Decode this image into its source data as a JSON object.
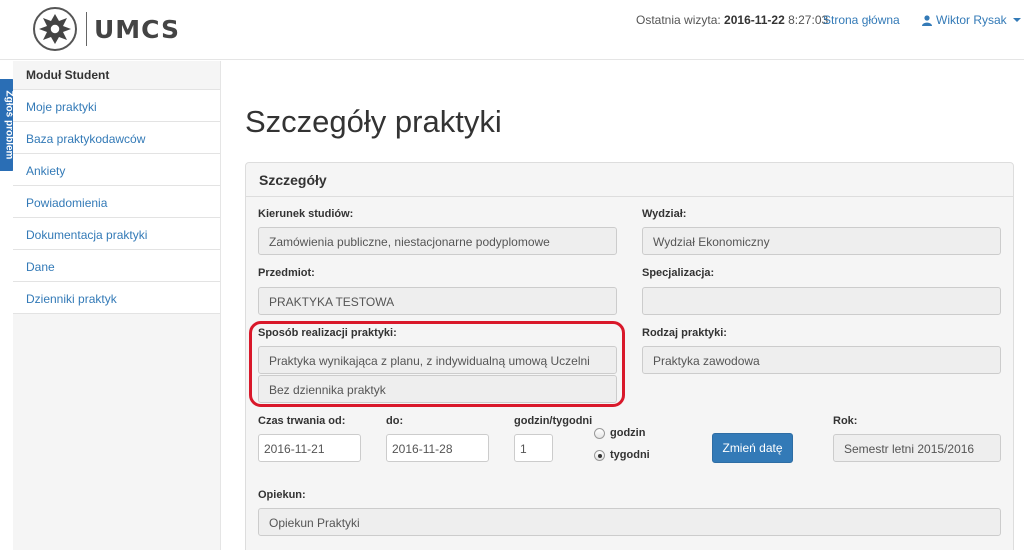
{
  "header": {
    "logo_text": "UMCS",
    "last_visit_label": "Ostatnia wizyta:",
    "last_visit_date": "2016-11-22",
    "last_visit_time": "8:27:03",
    "home_link": "Strona główna",
    "user_name": "Wiktor Rysak"
  },
  "feedback_tab": "Zgłoś problem",
  "sidebar": {
    "title": "Moduł Student",
    "items": [
      {
        "label": "Moje praktyki"
      },
      {
        "label": "Baza praktykodawców"
      },
      {
        "label": "Ankiety"
      },
      {
        "label": "Powiadomienia"
      },
      {
        "label": "Dokumentacja praktyki"
      },
      {
        "label": "Dane"
      },
      {
        "label": "Dzienniki praktyk"
      }
    ]
  },
  "main": {
    "page_title": "Szczegóły praktyki",
    "panel_title": "Szczegóły",
    "fields": {
      "kierunek": {
        "label": "Kierunek studiów:",
        "value": "Zamówienia publiczne, niestacjonarne podyplomowe"
      },
      "wydzial": {
        "label": "Wydział:",
        "value": "Wydział Ekonomiczny"
      },
      "przedmiot": {
        "label": "Przedmiot:",
        "value": "PRAKTYKA TESTOWA"
      },
      "specjalizacja": {
        "label": "Specjalizacja:",
        "value": ""
      },
      "sposob": {
        "label": "Sposób realizacji praktyki:",
        "value": "Praktyka wynikająca z planu, z indywidualną umową Uczelni",
        "value2": "Bez dziennika praktyk"
      },
      "rodzaj": {
        "label": "Rodzaj praktyki:",
        "value": "Praktyka zawodowa"
      },
      "czas_od": {
        "label": "Czas trwania od:",
        "value": "2016-11-21"
      },
      "czas_do": {
        "label": "do:",
        "value": "2016-11-28"
      },
      "godzin_tygodni": {
        "label": "godzin/tygodni",
        "value": "1"
      },
      "unit_options": [
        {
          "label": "godzin",
          "selected": false
        },
        {
          "label": "tygodni",
          "selected": true
        }
      ],
      "change_date_button": "Zmień datę",
      "rok": {
        "label": "Rok:",
        "value": "Semestr letni 2015/2016"
      },
      "opiekun": {
        "label": "Opiekun:",
        "value": "Opiekun Praktyki"
      }
    }
  },
  "colors": {
    "accent": "#337ab7",
    "highlight": "#d9182a",
    "feedback_tab": "#2a6eb5"
  }
}
